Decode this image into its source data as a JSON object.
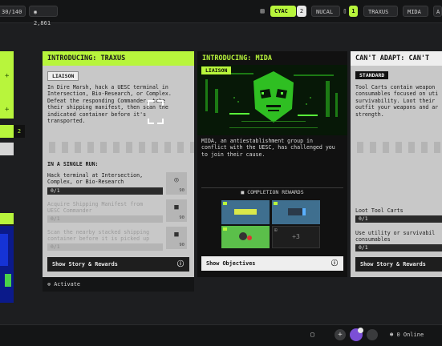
{
  "topbar": {
    "progress_text": "30/140",
    "currency": "2,861",
    "factions": [
      {
        "label": "CYAC",
        "count": "2"
      },
      {
        "label": "NUCAL",
        "count": "1"
      },
      {
        "label": "TRAXUS"
      },
      {
        "label": "MIDA"
      },
      {
        "label": "A"
      }
    ]
  },
  "left_column": {
    "count": "2"
  },
  "cards": {
    "traxus": {
      "title": "INTRODUCING: TRAXUS",
      "tag": "LIAISON",
      "description": "In Dire Marsh, hack a UESC terminal in\nIntersection, Bio-Research, or Complex.\nDefeat the responding Commander, take\ntheir shipping manifest, then scan the\nindicated container before it's\ntransported.",
      "section_label": "IN A SINGLE RUN:",
      "tasks": [
        {
          "text": "Hack terminal at Intersection,\nComplex, or Bio-Research",
          "progress": "0/1",
          "reward": "90"
        },
        {
          "text": "Acquire Shipping Manifest from\nUESC Commander",
          "progress": "0/1",
          "reward": "90"
        },
        {
          "text": "Scan the nearby stacked shipping\ncontainer before it is picked up",
          "progress": "0/1",
          "reward": "90"
        }
      ],
      "button": "Show Story & Rewards",
      "activate": "Activate"
    },
    "mida": {
      "title": "INTRODUCING: MIDA",
      "tag": "LIAISON",
      "description": "MIDA, an antiestablishment group in\nconflict with the UESC, has challenged you\nto join their cause.",
      "rewards_label": "COMPLETION REWARDS",
      "rewards_extra": "+3",
      "button": "Show Objectives"
    },
    "adapt": {
      "title": "CAN'T ADAPT: CAN'T",
      "tag": "STANDARD",
      "description": "Tool Carts contain weapon\nconsumables focused on uti\nsurvivability. Loot their\noutfit your weapons and ar\nstrength.",
      "tasks": [
        {
          "text": "Loot Tool Carts",
          "progress": "0/1"
        },
        {
          "text": "Use utility or survivabil\nconsumables",
          "progress": "0/1"
        }
      ],
      "button": "Show Story & Rewards"
    }
  },
  "footer": {
    "online": "0 Online"
  },
  "colors": {
    "accent": "#b8f53c",
    "card": "#c8c8c8",
    "dark": "#111111"
  }
}
